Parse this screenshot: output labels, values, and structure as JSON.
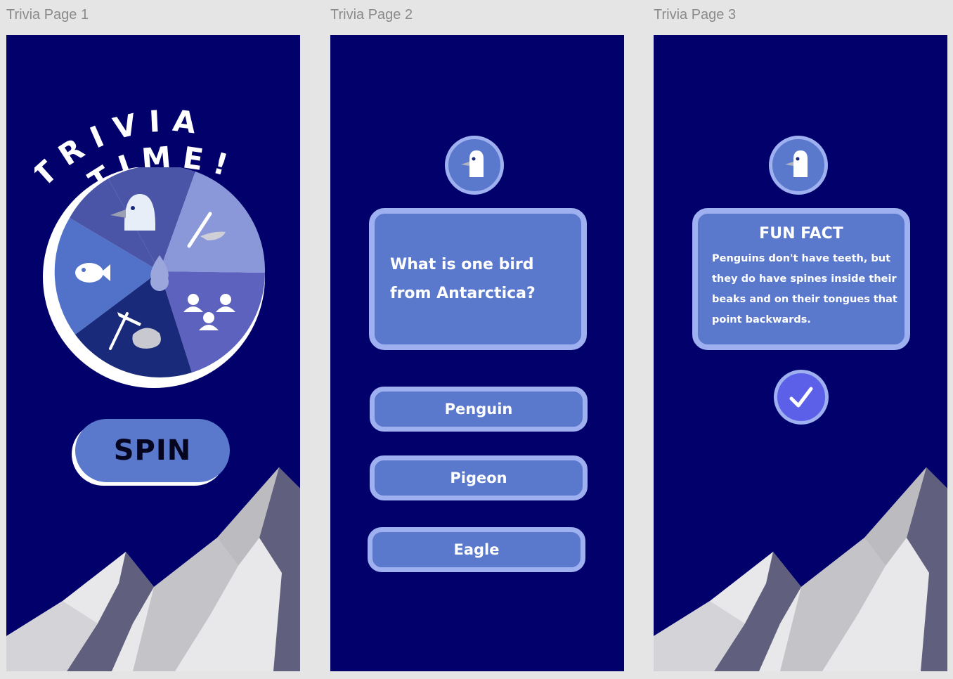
{
  "frames": [
    {
      "label": "Trivia Page 1",
      "title_line1": "TRIVIA",
      "title_line2": "TIME!",
      "spin_label": "SPIN",
      "wheel_icons": [
        "penguin-icon",
        "fishing-rod-icon",
        "people-icon",
        "ice-pick-icon",
        "fish-icon"
      ]
    },
    {
      "label": "Trivia Page 2",
      "question": "What is one bird from Antarctica?",
      "answers": [
        "Penguin",
        "Pigeon",
        "Eagle"
      ]
    },
    {
      "label": "Trivia Page 3",
      "fact_title": "FUN FACT",
      "fact_body": "Penguins don't have teeth, but they do have spines inside their beaks and on their tongues that point backwards."
    }
  ],
  "colors": {
    "background": "#02006a",
    "button": "#5a78cc",
    "button_border": "#9eb0f0",
    "check": "#5c5fe8"
  }
}
